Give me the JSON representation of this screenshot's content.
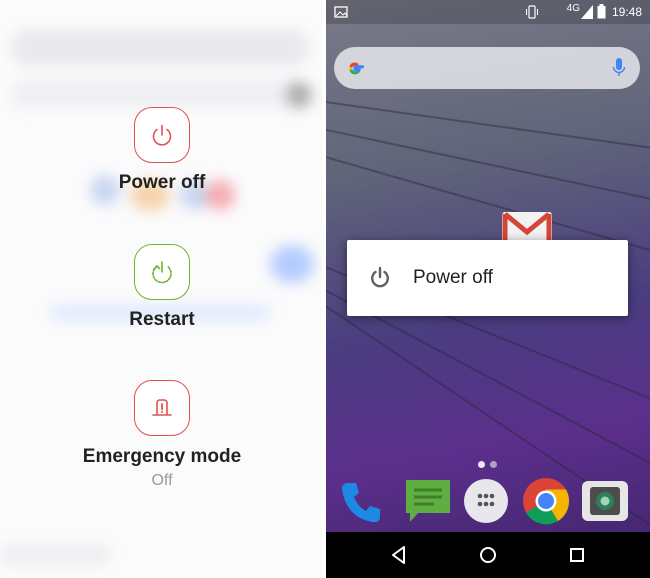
{
  "left_menu": {
    "items": [
      {
        "id": "power_off",
        "label": "Power off",
        "icon": "power-icon",
        "color": "#e05054"
      },
      {
        "id": "restart",
        "label": "Restart",
        "icon": "restart-icon",
        "color": "#6cb52d"
      },
      {
        "id": "emergency",
        "label": "Emergency mode",
        "sublabel": "Off",
        "icon": "siren-icon",
        "color": "#e05054"
      }
    ]
  },
  "status_bar": {
    "network": "4G",
    "time": "19:48"
  },
  "power_dialog": {
    "label": "Power off",
    "icon": "power-icon"
  },
  "dock": {
    "apps": [
      "phone-icon",
      "messages-icon",
      "app-drawer-icon",
      "chrome-icon",
      "camera-icon"
    ]
  },
  "colors": {
    "red_accent": "#e05054",
    "green_accent": "#6cb52d",
    "wallpaper_purple": "#5b2f8c"
  }
}
